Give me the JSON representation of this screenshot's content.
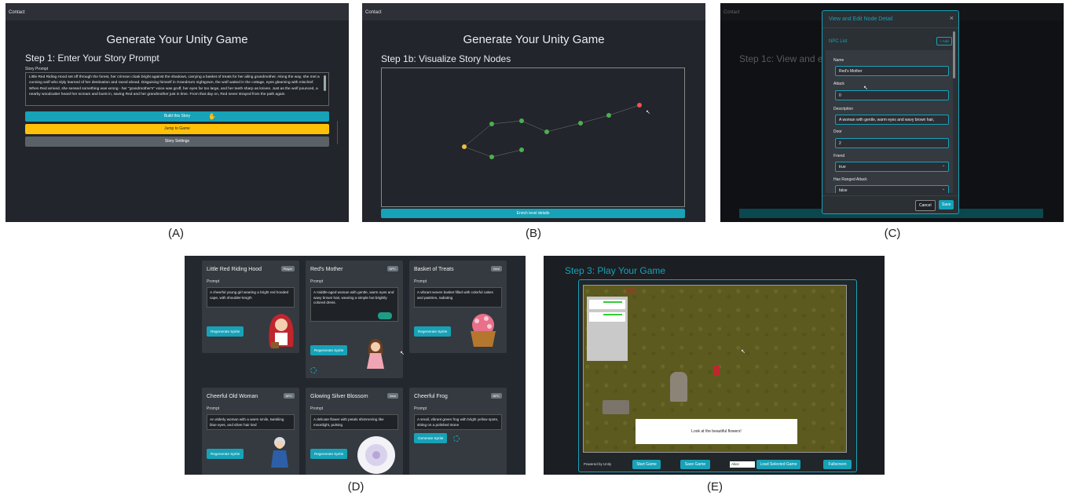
{
  "captions": {
    "a": "(A)",
    "b": "(B)",
    "c": "(C)",
    "d": "(D)",
    "e": "(E)"
  },
  "panel_a": {
    "topbar": "Contact",
    "title": "Generate Your Unity Game",
    "step": "Step 1: Enter Your Story Prompt",
    "prompt_label": "Story Prompt",
    "prompt_text": "Little Red Riding Hood set off through the forest, her crimson cloak bright against the shadows, carrying a basket of treats for her ailing grandmother. Along the way, she met a cunning wolf who slyly learned of her destination and raced ahead. Disguising himself in Grandma's nightgown, the wolf waited in the cottage, eyes gleaming with mischief. When Red arrived, she sensed something was wrong - her \"grandmother's\" voice was gruff, her eyes far too large, and her teeth sharp as knives. Just as the wolf pounced, a nearby woodcutter heard her scream and burst in, saving Red and her grandmother just in time. From that day on, Red never strayed from the path again.",
    "btn_build": "Build this Story",
    "btn_jump": "Jump to Game",
    "btn_settings": "Story Settings"
  },
  "panel_b": {
    "topbar": "Contact",
    "title": "Generate Your Unity Game",
    "step": "Step 1b: Visualize Story Nodes",
    "btn_enrich": "Enrich level details"
  },
  "panel_c": {
    "topbar": "Contact",
    "bg_step": "Step 1c: View and ed",
    "modal_title": "View and Edit Node Detail",
    "close": "×",
    "npc_list": "NPC List",
    "add": "+ Add",
    "fields": [
      {
        "label": "Name",
        "value": "Red's Mother"
      },
      {
        "label": "Attack",
        "value": "0"
      },
      {
        "label": "Description",
        "value": "A woman with gentle, warm eyes and wavy brown hair,"
      },
      {
        "label": "Door",
        "value": "2"
      },
      {
        "label": "Friend",
        "value": "true"
      },
      {
        "label": "Has Ranged Attack",
        "value": "false"
      }
    ],
    "cancel": "Cancel",
    "save": "Save"
  },
  "panel_d": {
    "prompt_label": "Prompt",
    "cards": [
      {
        "title": "Little Red Riding Hood",
        "badge": "Player",
        "prompt": "A cheerful young girl wearing a bright red hooded cape, with shoulder-length",
        "button": "Regenerate Sprite"
      },
      {
        "title": "Red's Mother",
        "badge": "NPC",
        "prompt": "A middle-aged woman with gentle, warm eyes and wavy brown hair, wearing a simple but brightly colored dress.",
        "button": "Regenerate Sprite"
      },
      {
        "title": "Basket of Treats",
        "badge": "Item",
        "prompt": "A vibrant woven basket filled with colorful cakes and pastries, radiating",
        "button": "Regenerate Sprite"
      },
      {
        "title": "Cheerful Old Woman",
        "badge": "NPC",
        "prompt": "An elderly woman with a warm smile, twinkling blue eyes, and silver hair tied",
        "button": "Regenerate Sprite"
      },
      {
        "title": "Glowing Silver Blossom",
        "badge": "Item",
        "prompt": "A delicate flower with petals shimmering like moonlight, pulsing",
        "button": "Regenerate Sprite"
      },
      {
        "title": "Cheerful Frog",
        "badge": "NPC",
        "prompt": "A small, vibrant green frog with bright yellow spots, sitting on a polished stone",
        "button": "Generate Sprite"
      }
    ]
  },
  "panel_e": {
    "step": "Step 3: Play Your Game",
    "dialog": "Look at the beautiful flowers!",
    "powered": "Powered by Unity",
    "start": "Start Game",
    "save": "Save Game",
    "select_value": "Alice",
    "load": "Load Selected Game",
    "fullscreen": "Fullscreen"
  }
}
